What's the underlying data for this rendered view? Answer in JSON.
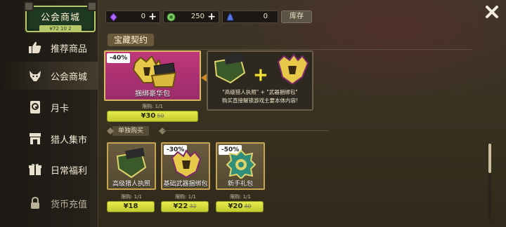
{
  "shop": {
    "title": "公会商城",
    "subtitle": "¥72 10 2"
  },
  "currencies": [
    {
      "name": "purple-gem",
      "value": "0",
      "color": "#a45cff"
    },
    {
      "name": "green-coin",
      "value": "250",
      "color": "#7fd16a"
    },
    {
      "name": "blue-crystal",
      "value": "0",
      "color": "#5a78e8"
    }
  ],
  "stock_label": "库存",
  "sidebar": {
    "items": [
      {
        "label": "推荐商品",
        "icon": "thumbs-up-icon"
      },
      {
        "label": "公会商城",
        "icon": "wolf-icon"
      },
      {
        "label": "月卡",
        "icon": "card-icon"
      },
      {
        "label": "猎人集市",
        "icon": "market-icon"
      },
      {
        "label": "日常福利",
        "icon": "gift-icon"
      },
      {
        "label": "货币充值",
        "icon": "lock-icon"
      }
    ]
  },
  "section": {
    "title": "宝藏契约"
  },
  "bundle": {
    "discount": "-40%",
    "name": "捆绑豪华包",
    "limit": "限购: 1/1",
    "price": "¥30",
    "old_price": "50"
  },
  "preview": {
    "line1": "\"高级猎人执照\" + \"武器捆绑包\"",
    "line2": "购买直接解锁游戏主要本体内容!"
  },
  "single": {
    "title": "单独购买"
  },
  "items": [
    {
      "name": "高级猎人执照",
      "discount": "",
      "limit": "限购: 1/1",
      "price": "¥18",
      "old_price": ""
    },
    {
      "name": "基础武器捆绑包",
      "discount": "-30%",
      "limit": "限购: 1/1",
      "price": "¥22",
      "old_price": "32"
    },
    {
      "name": "新手礼包",
      "discount": "-50%",
      "limit": "限购: 1/1",
      "price": "¥20",
      "old_price": "40"
    }
  ]
}
